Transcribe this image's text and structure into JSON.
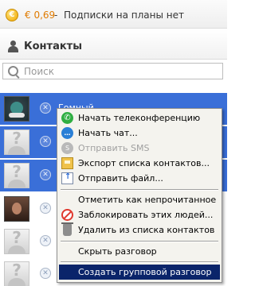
{
  "credit_bar": {
    "coin_glyph": "€",
    "amount": "€ 0,69",
    "separator": "-",
    "text": "Подписки на планы нет"
  },
  "contacts_header": {
    "title": "Контакты"
  },
  "search": {
    "placeholder": "Поиск"
  },
  "contact_list": {
    "selected_contact_name": "Гомный",
    "avatar_placeholder_glyph": "?",
    "status_glyph": "✕"
  },
  "context_menu": {
    "items": [
      {
        "label": "Начать телеконференцию",
        "icon": "phone-icon",
        "enabled": true
      },
      {
        "label": "Начать чат...",
        "icon": "chat-icon",
        "enabled": true
      },
      {
        "label": "Отправить SMS",
        "icon": "sms-icon",
        "enabled": false
      },
      {
        "label": "Экспорт списка контактов...",
        "icon": "export-contacts-icon",
        "enabled": true
      },
      {
        "label": "Отправить файл...",
        "icon": "send-file-icon",
        "enabled": true
      },
      {
        "label": "Отметить как непрочитанное",
        "icon": "",
        "enabled": true
      },
      {
        "label": "Заблокировать этих людей...",
        "icon": "block-icon",
        "enabled": true
      },
      {
        "label": "Удалить из списка контактов",
        "icon": "trash-icon",
        "enabled": true
      },
      {
        "label": "Скрыть разговор",
        "icon": "",
        "enabled": true
      },
      {
        "label": "Создать групповой разговор",
        "icon": "",
        "enabled": true,
        "highlighted": true
      }
    ],
    "icon_glyphs": {
      "phone": "✆",
      "chat": "…",
      "sms": "S"
    }
  },
  "colors": {
    "selection_blue": "#3a6fd8",
    "menu_background": "#f4f3ee",
    "menu_highlight": "#0a246a",
    "credit_amount": "#e07b00"
  }
}
